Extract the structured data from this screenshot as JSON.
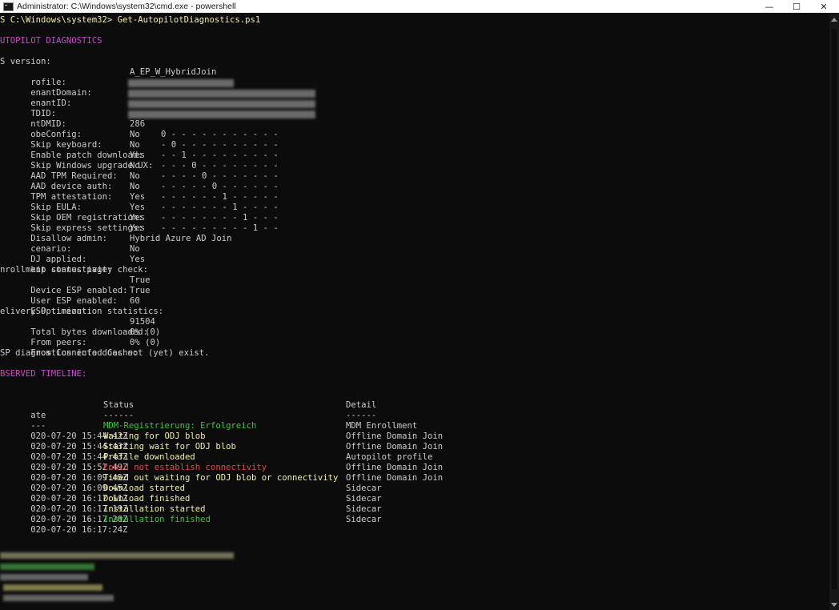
{
  "window": {
    "title": "Administrator: C:\\Windows\\system32\\cmd.exe - powershell",
    "controls": [
      "—",
      "☐",
      "✕"
    ]
  },
  "terminal": {
    "prompt": "S C:\\Windows\\system32> Get-AutopilotDiagnostics.ps1",
    "header": "UTOPILOT DIAGNOSTICS",
    "os_version": "S version:",
    "fields": [
      {
        "label": "rofile:",
        "value": "A_EP_W_HybridJoin"
      },
      {
        "label": "enantDomain:",
        "value": ""
      },
      {
        "label": "enantID:",
        "value": ""
      },
      {
        "label": "TDID:",
        "value": ""
      },
      {
        "label": "ntDMID:",
        "value": ""
      },
      {
        "label": "obeConfig:",
        "value": "286"
      }
    ],
    "flags": [
      {
        "label": "Skip keyboard:",
        "value": "No",
        "bar": "0 - - - - - - - - - - -"
      },
      {
        "label": "Enable patch download:",
        "value": "No",
        "bar": "- 0 - - - - - - - - - -"
      },
      {
        "label": "Skip Windows upgrade UX:",
        "value": "Yes",
        "bar": "- - 1 - - - - - - - - -"
      },
      {
        "label": "AAD TPM Required:",
        "value": "No",
        "bar": "- - - 0 - - - - - - - -"
      },
      {
        "label": "AAD device auth:",
        "value": "No",
        "bar": "- - - - 0 - - - - - - -"
      },
      {
        "label": "TPM attestation:",
        "value": "No",
        "bar": "- - - - - 0 - - - - - -"
      },
      {
        "label": "Skip EULA:",
        "value": "Yes",
        "bar": "- - - - - - 1 - - - - -"
      },
      {
        "label": "Skip OEM registration:",
        "value": "Yes",
        "bar": "- - - - - - - 1 - - - -"
      },
      {
        "label": "Skip express settings:",
        "value": "Yes",
        "bar": "- - - - - - - - 1 - - -"
      },
      {
        "label": "Disallow admin:",
        "value": "Yes",
        "bar": "- - - - - - - - - 1 - -"
      }
    ],
    "scenario": {
      "label": "cenario:",
      "value": "Hybrid Azure AD Join"
    },
    "odj": {
      "label": "DJ applied:",
      "value": "No"
    },
    "skip_conn": {
      "label": "kip connectivity check:",
      "value": "Yes"
    },
    "esp_header": "nrollment status page:",
    "esp": [
      {
        "label": "Device ESP enabled:",
        "value": "True"
      },
      {
        "label": "User ESP enabled:",
        "value": "True"
      },
      {
        "label": "ESP timeout:",
        "value": "60"
      }
    ],
    "do_header": "elivery Optimization statistics:",
    "do_stats": [
      {
        "label": "Total bytes downloaded:",
        "value": "91504"
      },
      {
        "label": "From peers:",
        "value": "0% (0)"
      },
      {
        "label": "From Connected Cache:",
        "value": "0% (0)"
      }
    ],
    "sp_note": "SP diagnostics info does not (yet) exist.",
    "timeline_header": "BSERVED TIMELINE:",
    "columns": {
      "date": "ate",
      "status": "Status",
      "detail": "Detail"
    },
    "underline": {
      "date": "---",
      "status": "------",
      "detail": "------"
    },
    "timeline": [
      {
        "date": "020-07-20 15:44:42Z",
        "status": "MDM-Registrierung: Erfolgreich",
        "detail": "MDM Enrollment",
        "color": "green"
      },
      {
        "date": "020-07-20 15:44:43Z",
        "status": "Waiting for ODJ blob",
        "detail": "Offline Domain Join",
        "color": "yellow"
      },
      {
        "date": "020-07-20 15:44:43Z",
        "status": "Starting wait for ODJ blob",
        "detail": "Offline Domain Join",
        "color": "yellow"
      },
      {
        "date": "020-07-20 15:52:49Z",
        "status": "Profile downloaded",
        "detail": "Autopilot profile",
        "color": "yellow"
      },
      {
        "date": "020-07-20 16:09:45Z",
        "status": "Could not establish connectivity",
        "detail": "Offline Domain Join",
        "color": "red"
      },
      {
        "date": "020-07-20 16:09:45Z",
        "status": "Timed out waiting for ODJ blob or connectivity",
        "detail": "Offline Domain Join",
        "color": "yellow"
      },
      {
        "date": "020-07-20 16:17:11Z",
        "status": "Download started",
        "detail": "Sidecar",
        "color": "yellow"
      },
      {
        "date": "020-07-20 16:17:19Z",
        "status": "Download finished",
        "detail": "Sidecar",
        "color": "yellow"
      },
      {
        "date": "020-07-20 16:17:20Z",
        "status": "Installation started",
        "detail": "Sidecar",
        "color": "yellow"
      },
      {
        "date": "020-07-20 16:17:24Z",
        "status": "Installation finished",
        "detail": "Sidecar",
        "color": "green"
      }
    ]
  },
  "colors": {
    "background": "#0c0c0c",
    "text": "#cccccc",
    "header": "#c44bc4",
    "yellow": "#f1f0a8",
    "green": "#3fc13f",
    "red": "#e5474b"
  }
}
